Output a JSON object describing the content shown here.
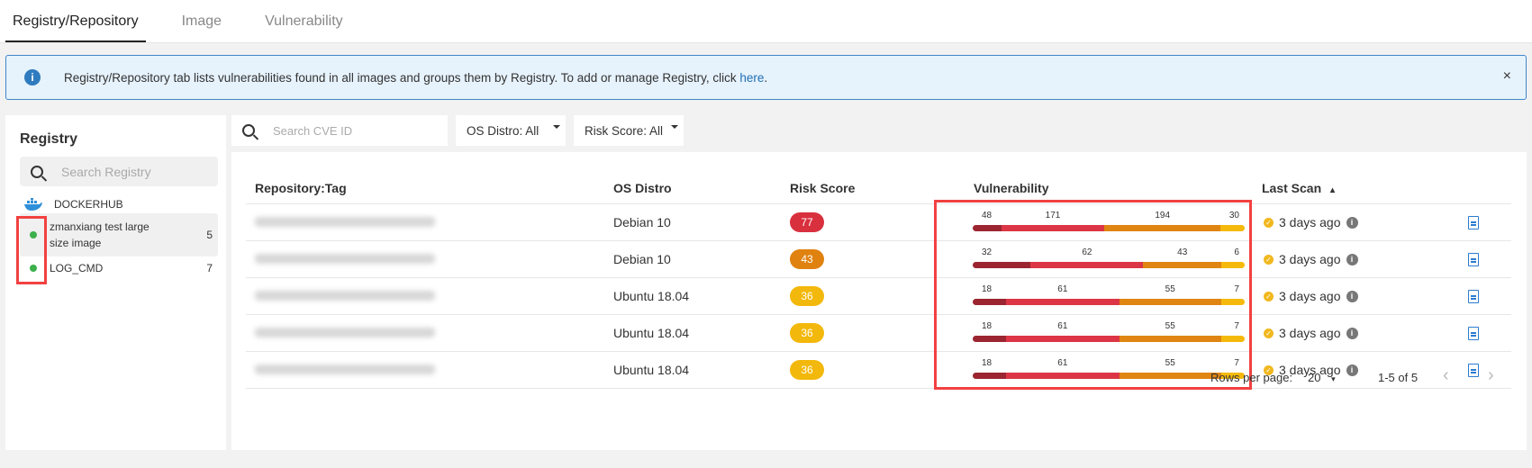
{
  "tabs": [
    "Registry/Repository",
    "Image",
    "Vulnerability"
  ],
  "alert": {
    "text": "Registry/Repository tab lists vulnerabilities found in all images and groups them by Registry. To add or manage Registry, click ",
    "link": "here",
    "end": ".",
    "close": "×"
  },
  "sidebar": {
    "title": "Registry",
    "search_placeholder": "Search Registry",
    "group": "DOCKERHUB",
    "items": [
      {
        "label": "zmanxiang test large size image",
        "count": "5"
      },
      {
        "label": "LOG_CMD",
        "count": "7"
      }
    ]
  },
  "filters": {
    "cve_placeholder": "Search CVE ID",
    "os": "OS Distro: All",
    "risk": "Risk Score: All"
  },
  "table": {
    "headers": {
      "repo": "Repository:Tag",
      "os": "OS Distro",
      "risk": "Risk Score",
      "vuln": "Vulnerability",
      "scan": "Last Scan",
      "sort": "▴"
    },
    "rows": [
      {
        "os": "Debian 10",
        "risk": "77",
        "risk_color": "#d9303e",
        "vuln": [
          48,
          171,
          194,
          30
        ],
        "scan": "3 days ago"
      },
      {
        "os": "Debian 10",
        "risk": "43",
        "risk_color": "#e0820f",
        "vuln": [
          32,
          62,
          43,
          6
        ],
        "scan": "3 days ago"
      },
      {
        "os": "Ubuntu 18.04",
        "risk": "36",
        "risk_color": "#f3b80c",
        "vuln": [
          18,
          61,
          55,
          7
        ],
        "scan": "3 days ago"
      },
      {
        "os": "Ubuntu 18.04",
        "risk": "36",
        "risk_color": "#f3b80c",
        "vuln": [
          18,
          61,
          55,
          7
        ],
        "scan": "3 days ago"
      },
      {
        "os": "Ubuntu 18.04",
        "risk": "36",
        "risk_color": "#f3b80c",
        "vuln": [
          18,
          61,
          55,
          7
        ],
        "scan": "3 days ago"
      }
    ]
  },
  "severity_colors": [
    "#9b2530",
    "#dc3545",
    "#e08512",
    "#f5b90b"
  ],
  "pagination": {
    "rows_label": "Rows per page:",
    "rows_value": "20",
    "range": "1-5 of 5",
    "prev": "‹",
    "next": "›"
  }
}
